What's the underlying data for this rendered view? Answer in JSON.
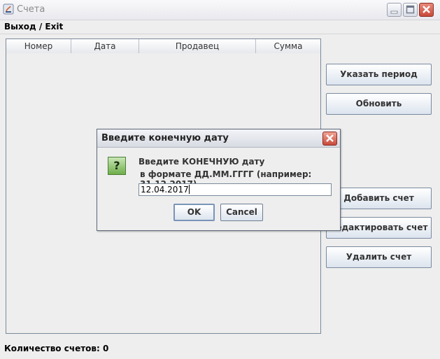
{
  "window": {
    "title": "Счета"
  },
  "menu": {
    "items": [
      {
        "label": "Выход / Exit"
      }
    ]
  },
  "table": {
    "columns": [
      "Номер",
      "Дата",
      "Продавец",
      "Сумма"
    ],
    "rows": []
  },
  "side_buttons": {
    "period": "Указать период",
    "refresh": "Обновить",
    "add": "Добавить счет",
    "edit": "Редактировать счет",
    "delete": "Удалить счет"
  },
  "status": {
    "text": "Количество счетов: 0"
  },
  "dialog": {
    "title": "Введите конечную дату",
    "message_line1": "Введите КОНЕЧНУЮ дату",
    "message_line2": "в формате ДД.ММ.ГГГГ (например: 31.12.2017)",
    "input_value": "12.04.2017",
    "ok_label": "OK",
    "cancel_label": "Cancel"
  },
  "icons": {
    "app": "app-window-icon",
    "minimize": "minimize-icon",
    "maximize": "maximize-icon",
    "close": "close-icon",
    "question": "question-icon"
  }
}
